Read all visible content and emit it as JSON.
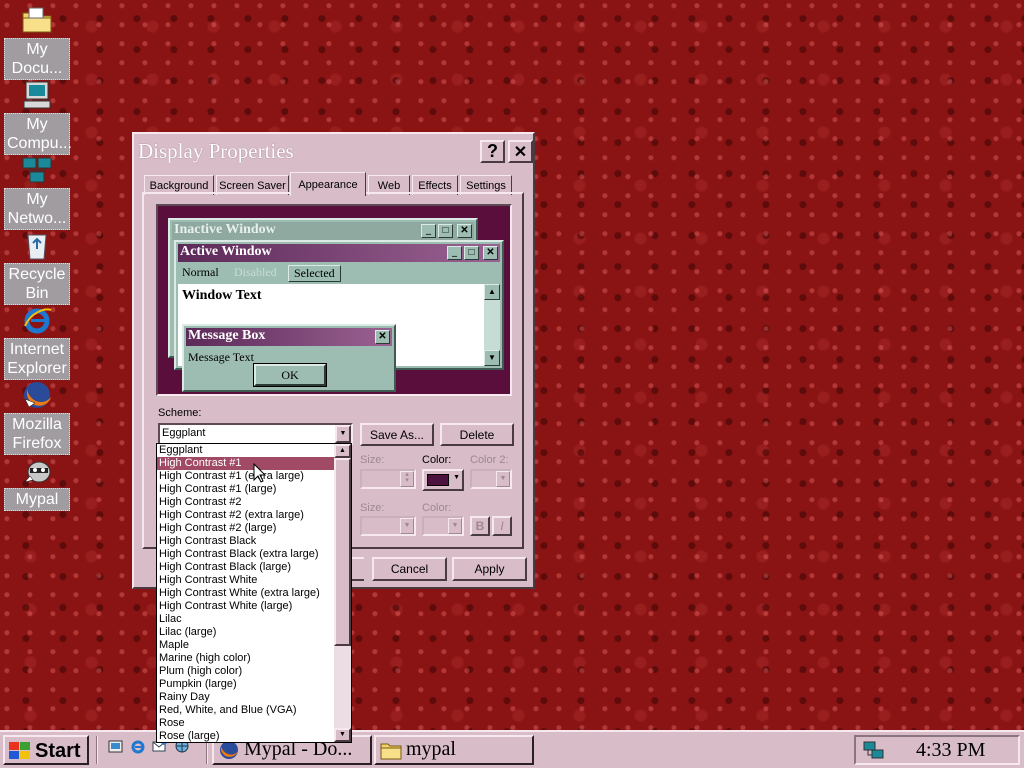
{
  "desktop": {
    "icons": [
      {
        "label": "My\nDocu...",
        "icon": "folder-icon"
      },
      {
        "label": "My\nCompu...",
        "icon": "computer-icon"
      },
      {
        "label": "My\nNetwo...",
        "icon": "network-icon"
      },
      {
        "label": "Recycle\nBin",
        "icon": "recycle-bin-icon"
      },
      {
        "label": "Internet\nExplorer",
        "icon": "internet-explorer-icon"
      },
      {
        "label": "Mozilla\nFirefox",
        "icon": "firefox-icon"
      },
      {
        "label": "Mypal",
        "icon": "mypal-icon"
      }
    ]
  },
  "dialog": {
    "title": "Display Properties",
    "help_glyph": "?",
    "close_glyph": "✕",
    "tabs": [
      "Background",
      "Screen Saver",
      "Appearance",
      "Web",
      "Effects",
      "Settings"
    ],
    "active_tab": "Appearance",
    "preview": {
      "inactive_title": "Inactive Window",
      "active_title": "Active Window",
      "menu_normal": "Normal",
      "menu_disabled": "Disabled",
      "menu_selected": "Selected",
      "window_text": "Window Text",
      "msgbox_title": "Message Box",
      "msgbox_text": "Message Text",
      "ok_label": "OK"
    },
    "scheme_label": "Scheme:",
    "scheme_value": "Eggplant",
    "save_as_label": "Save As...",
    "delete_label": "Delete",
    "size_label": "Size:",
    "color_label": "Color:",
    "color2_label": "Color 2:",
    "size_label2": "Size:",
    "color_label2": "Color:",
    "bold_label": "B",
    "italic_label": "I",
    "cancel_label": "Cancel",
    "apply_label": "Apply",
    "accent_color": "#4b1240"
  },
  "scheme_list": {
    "selected": "High Contrast #1",
    "items": [
      "Eggplant",
      "High Contrast #1",
      "High Contrast #1 (extra large)",
      "High Contrast #1 (large)",
      "High Contrast #2",
      "High Contrast #2 (extra large)",
      "High Contrast #2 (large)",
      "High Contrast Black",
      "High Contrast Black (extra large)",
      "High Contrast Black (large)",
      "High Contrast White",
      "High Contrast White (extra large)",
      "High Contrast White (large)",
      "Lilac",
      "Lilac (large)",
      "Maple",
      "Marine (high color)",
      "Plum (high color)",
      "Pumpkin (large)",
      "Rainy Day",
      "Red, White, and Blue (VGA)",
      "Rose",
      "Rose (large)"
    ]
  },
  "taskbar": {
    "start_label": "Start",
    "tasks": [
      {
        "label": "Mypal - Do...",
        "icon": "firefox-icon"
      },
      {
        "label": "mypal",
        "icon": "folder-icon"
      }
    ],
    "clock": "4:33 PM"
  }
}
